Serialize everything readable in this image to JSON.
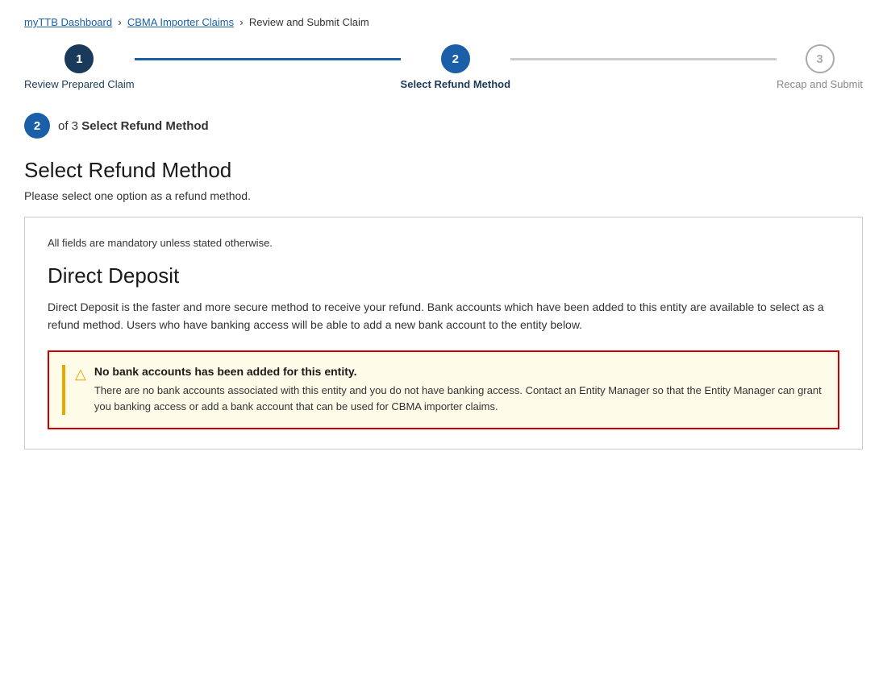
{
  "breadcrumb": {
    "link1": "myTTB Dashboard",
    "link2": "CBMA Importer Claims",
    "current": "Review and Submit Claim"
  },
  "stepper": {
    "steps": [
      {
        "number": "1",
        "label": "Review Prepared Claim",
        "state": "completed"
      },
      {
        "number": "2",
        "label": "Select Refund Method",
        "state": "active"
      },
      {
        "number": "3",
        "label": "Recap and Submit",
        "state": "inactive"
      }
    ]
  },
  "step_indicator": {
    "number": "2",
    "of_text": "of 3",
    "title": "Select Refund Method"
  },
  "page": {
    "title": "Select Refund Method",
    "subtitle": "Please select one option as a refund method."
  },
  "form_card": {
    "mandatory_note": "All fields are mandatory unless stated otherwise.",
    "section_title": "Direct Deposit",
    "description": "Direct Deposit is the faster and more secure method to receive your refund. Bank accounts which have been added to this entity are available to select as a refund method. Users who have banking access will be able to add a new bank account to the entity below.",
    "warning": {
      "title": "No bank accounts has been added for this entity.",
      "text": "There are no bank accounts associated with this entity and you do not have banking access. Contact an Entity Manager so that the Entity Manager can grant you banking access or add a bank account that can be used for CBMA importer claims."
    }
  }
}
